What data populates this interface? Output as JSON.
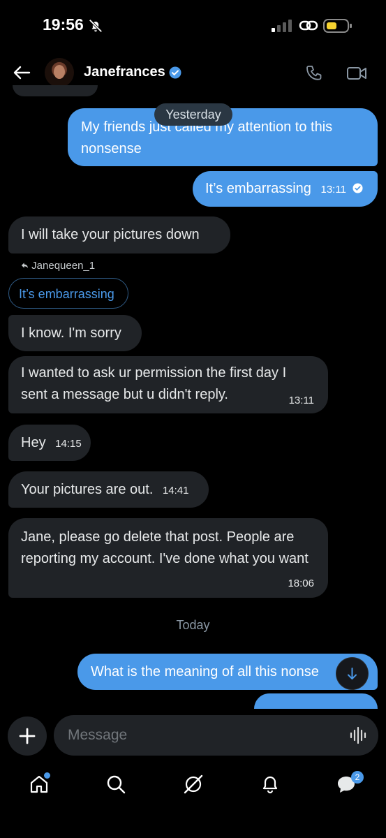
{
  "status": {
    "time": "19:56"
  },
  "header": {
    "name": "Janefrances"
  },
  "yesterday_label": "Yesterday",
  "today_label": "Today",
  "messages": [
    {
      "text": "My friends just called my attention to this nonsense"
    },
    {
      "text": "It’s embarrassing",
      "time": "13:11"
    },
    {
      "text": "I will take your pictures down"
    },
    {
      "text": "I know. I'm sorry"
    },
    {
      "text": "I wanted to ask ur permission the first day I sent a message but u didn't reply.",
      "time": "13:11"
    },
    {
      "text": "Hey",
      "time": "14:15"
    },
    {
      "text": "Your pictures are out.",
      "time": "14:41"
    },
    {
      "text": "Jane, please go delete that post. People are reporting my account. I've done what you want",
      "time": "18:06"
    },
    {
      "text": "What is the meaning of all this nonse"
    }
  ],
  "reply_ref": {
    "user": "Janequeen_1",
    "quoted": "It’s embarrassing"
  },
  "composer": {
    "placeholder": "Message"
  },
  "nav": {
    "messages_badge": "2"
  },
  "colors": {
    "accent": "#4a99e9",
    "bubble_in": "#202327",
    "background": "#000000"
  }
}
